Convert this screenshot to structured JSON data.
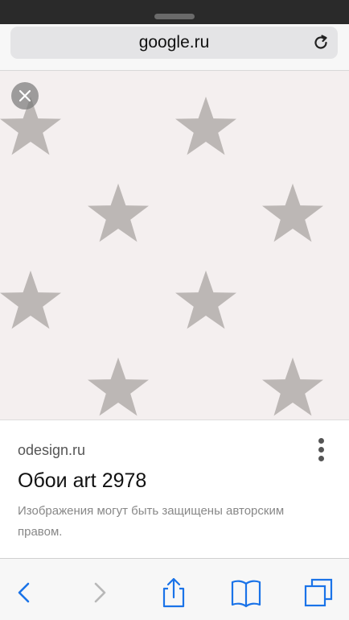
{
  "browser": {
    "url": "google.ru",
    "reload_icon": "reload-icon",
    "accent_color": "#1a73e8"
  },
  "viewer": {
    "close_icon": "close-icon",
    "image_background": "#f4efef",
    "star_color": "#b9b4b2"
  },
  "result": {
    "source": "odesign.ru",
    "title": "Обои art 2978",
    "notice": "Изображения могут быть защищены авторским правом.",
    "menu_icon": "more-vert-icon"
  },
  "toolbar": {
    "items": [
      {
        "name": "back",
        "icon": "chevron-left-icon"
      },
      {
        "name": "forward",
        "icon": "chevron-right-icon"
      },
      {
        "name": "share",
        "icon": "share-icon"
      },
      {
        "name": "bookmarks",
        "icon": "book-icon"
      },
      {
        "name": "tabs",
        "icon": "tabs-icon"
      }
    ]
  }
}
